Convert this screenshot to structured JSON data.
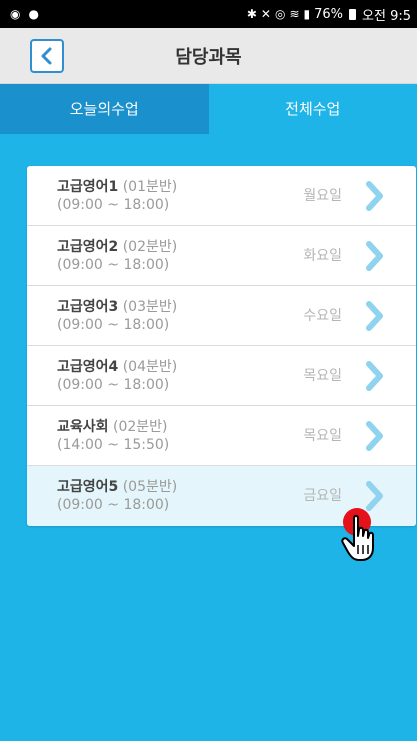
{
  "status_bar": {
    "right_text": "76%",
    "time": "오전 9:5"
  },
  "header": {
    "title": "담당과목"
  },
  "tabs": [
    {
      "label": "오늘의수업",
      "active": true
    },
    {
      "label": "전체수업",
      "active": false
    }
  ],
  "courses": [
    {
      "name": "고급영어1",
      "section": "(01분반)",
      "time": "(09:00 ~ 18:00)",
      "day": "월요일"
    },
    {
      "name": "고급영어2",
      "section": "(02분반)",
      "time": "(09:00 ~ 18:00)",
      "day": "화요일"
    },
    {
      "name": "고급영어3",
      "section": "(03분반)",
      "time": "(09:00 ~ 18:00)",
      "day": "수요일"
    },
    {
      "name": "고급영어4",
      "section": "(04분반)",
      "time": "(09:00 ~ 18:00)",
      "day": "목요일"
    },
    {
      "name": "교육사회",
      "section": "(02분반)",
      "time": "(14:00 ~ 15:50)",
      "day": "목요일"
    },
    {
      "name": "고급영어5",
      "section": "(05분반)",
      "time": "(09:00 ~ 18:00)",
      "day": "금요일"
    }
  ],
  "colors": {
    "accent": "#1eb4e8",
    "tab_active": "#1a90cc",
    "back_button_border": "#2f8fd0",
    "chevron": "#8fd3ef",
    "tap_indicator": "#e3121b"
  }
}
